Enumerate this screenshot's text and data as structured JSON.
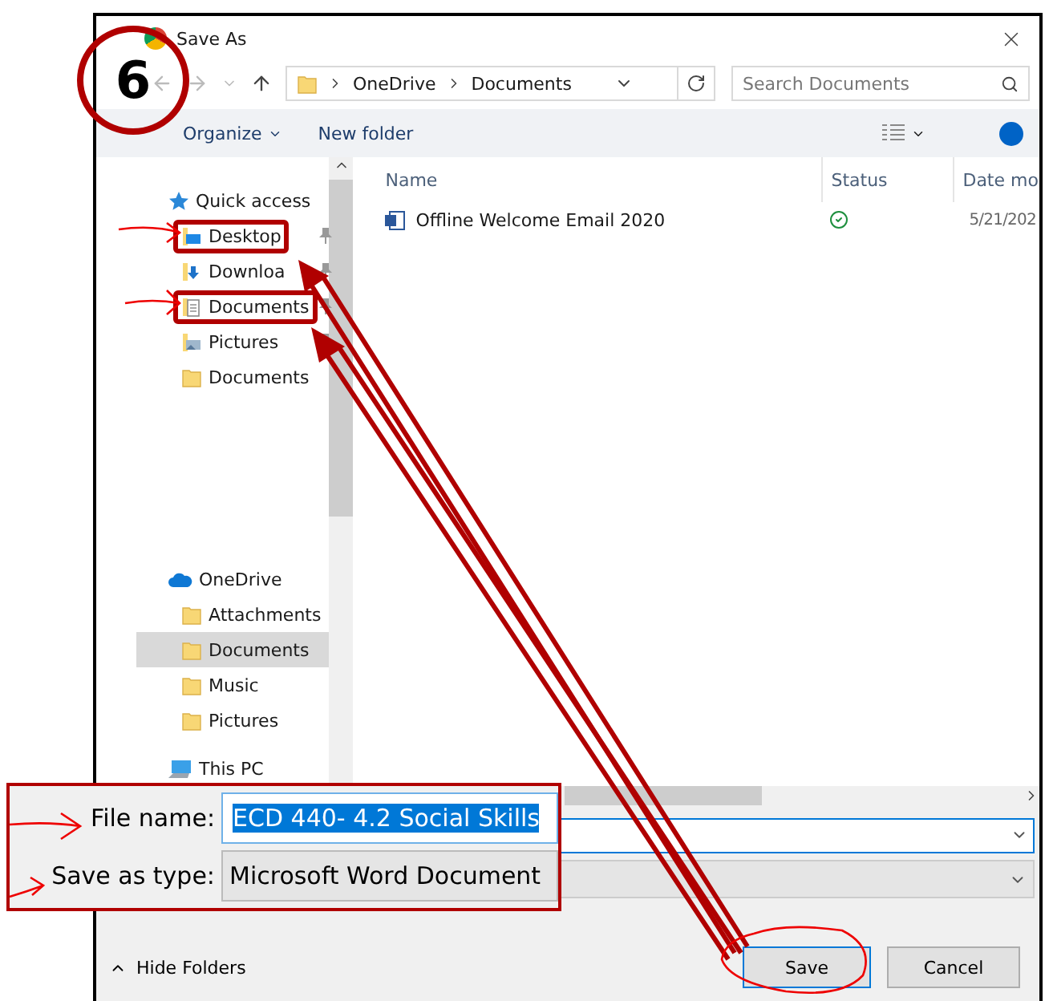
{
  "annotation": {
    "step": "6"
  },
  "window": {
    "title": "Save As"
  },
  "address": {
    "path": [
      "OneDrive",
      "Documents"
    ]
  },
  "search": {
    "placeholder": "Search Documents"
  },
  "toolbar": {
    "organize": "Organize",
    "new_folder": "New folder"
  },
  "nav": [
    {
      "label": "Quick access",
      "kind": "star",
      "children": [
        {
          "label": "Desktop",
          "kind": "desktop",
          "pinned": true,
          "annotated": true,
          "selected": false
        },
        {
          "label": "Downloa",
          "kind": "download",
          "pinned": true,
          "annotated": false,
          "selected": false
        },
        {
          "label": "Documents",
          "kind": "documents",
          "pinned": true,
          "annotated": true,
          "selected": false
        },
        {
          "label": "Pictures",
          "kind": "pictures",
          "pinned": true,
          "annotated": false,
          "selected": false
        },
        {
          "label": "Documents",
          "kind": "folder",
          "pinned": false,
          "annotated": false,
          "selected": false
        }
      ]
    },
    {
      "label": "OneDrive",
      "kind": "cloud",
      "children": [
        {
          "label": "Attachments",
          "kind": "folder",
          "pinned": false,
          "annotated": false,
          "selected": false
        },
        {
          "label": "Documents",
          "kind": "folder",
          "pinned": false,
          "annotated": false,
          "selected": true
        },
        {
          "label": "Music",
          "kind": "folder",
          "pinned": false,
          "annotated": false,
          "selected": false
        },
        {
          "label": "Pictures",
          "kind": "folder",
          "pinned": false,
          "annotated": false,
          "selected": false
        }
      ]
    },
    {
      "label": "This PC",
      "kind": "pc"
    }
  ],
  "columns": [
    "Name",
    "Status",
    "Date mo"
  ],
  "files": [
    {
      "name": "Offline Welcome Email 2020",
      "synced": true,
      "date": "5/21/202"
    }
  ],
  "file_name_label": "File name:",
  "file_name": "ECD 440- 4.2 Social Skills",
  "save_type_label": "Save as type:",
  "save_type": "Microsoft Word Document",
  "hide_folders": "Hide Folders",
  "buttons": [
    {
      "label": "Save",
      "default": true
    },
    {
      "label": "Cancel",
      "default": false
    }
  ]
}
